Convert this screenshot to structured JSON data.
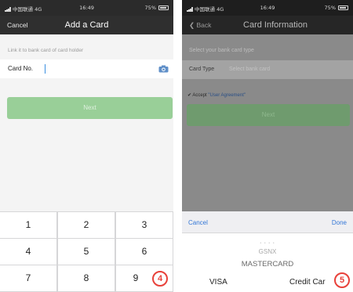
{
  "left": {
    "status": {
      "signal": "中国联通 4G",
      "time": "16:49",
      "battery": "75%"
    },
    "nav": {
      "cancel": "Cancel",
      "title": "Add a Card"
    },
    "hint": "Link it to bank card of card holder",
    "card_no_label": "Card No.",
    "next": "Next",
    "keys": [
      "1",
      "2",
      "3",
      "4",
      "5",
      "6",
      "7",
      "8",
      "9"
    ],
    "badge": "4"
  },
  "right": {
    "status": {
      "signal": "中国联通 4G",
      "time": "16:49",
      "battery": "75%"
    },
    "nav": {
      "back": "Back",
      "title": "Card Information"
    },
    "select_hint": "Select your bank card type",
    "card_type_label": "Card Type",
    "card_type_placeholder": "Select bank card",
    "accept_text": "Accept",
    "agreement": "\"User Agreement\"",
    "next": "Next",
    "picker": {
      "cancel": "Cancel",
      "done": "Done",
      "options_faded": [
        "GSNX",
        "MASTERCARD"
      ],
      "options_left": "VISA",
      "options_right": "Credit Car"
    },
    "badge": "5"
  },
  "colors": {
    "accent": "#99cf98",
    "badge": "#e8413a",
    "link": "#3477d6"
  }
}
